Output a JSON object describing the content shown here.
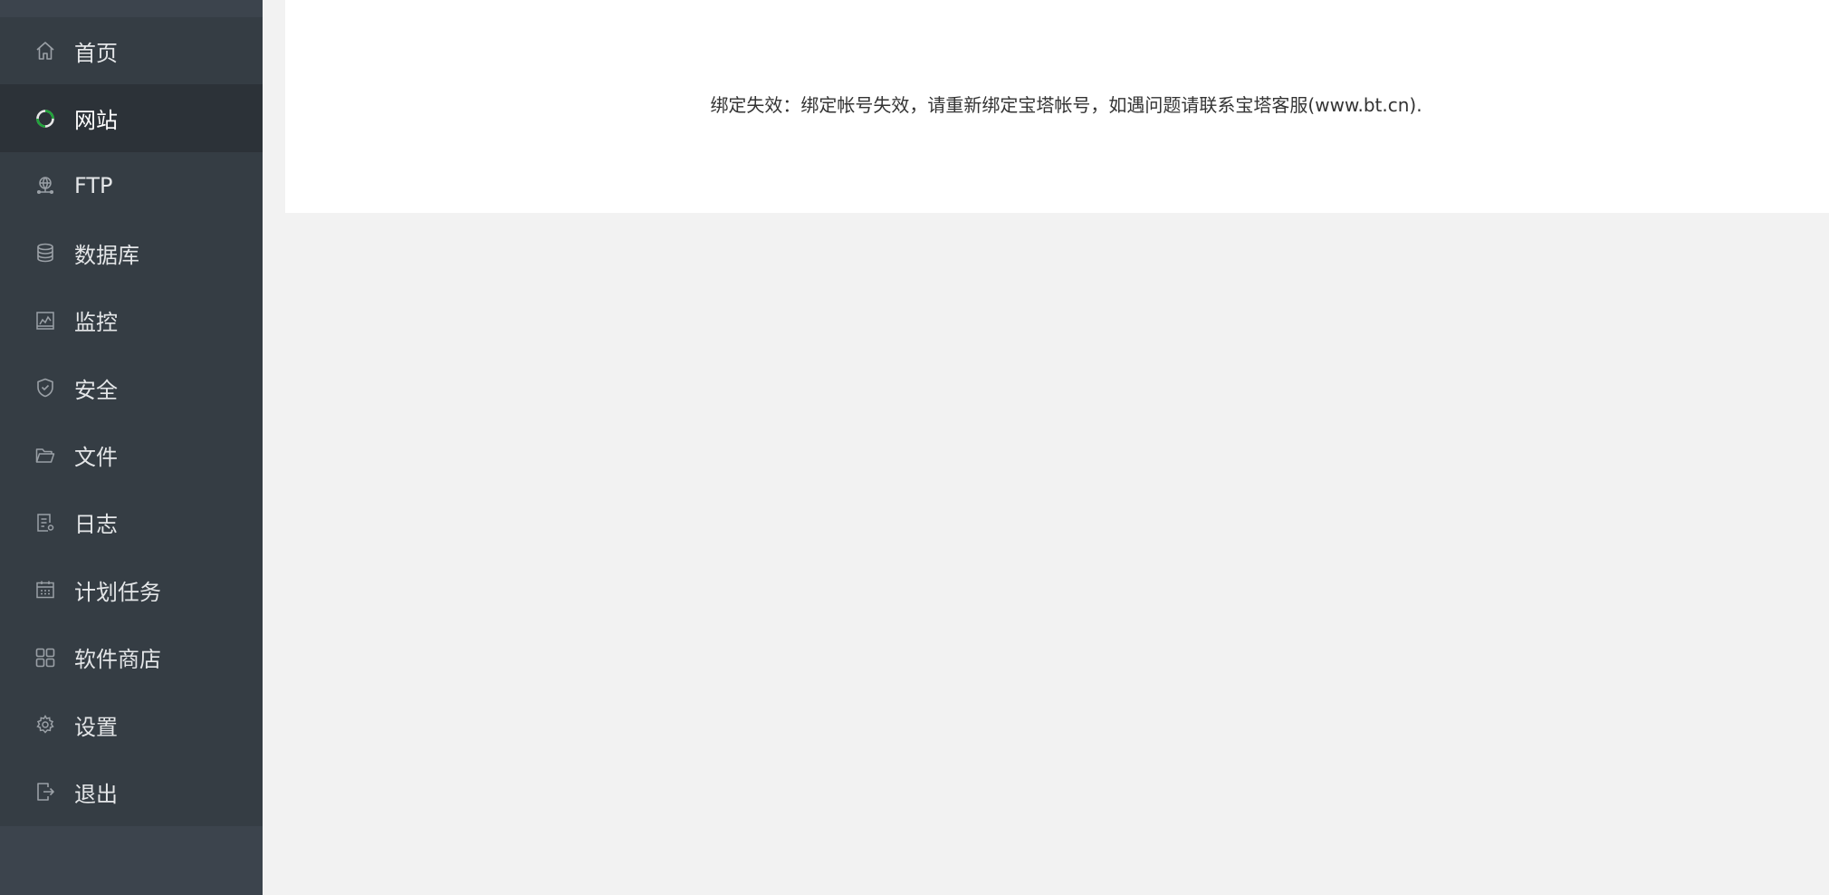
{
  "sidebar": {
    "items": [
      {
        "label": "首页",
        "icon": "home-icon"
      },
      {
        "label": "网站",
        "icon": "website-icon",
        "active": true
      },
      {
        "label": "FTP",
        "icon": "ftp-icon"
      },
      {
        "label": "数据库",
        "icon": "database-icon"
      },
      {
        "label": "监控",
        "icon": "monitor-icon"
      },
      {
        "label": "安全",
        "icon": "shield-icon"
      },
      {
        "label": "文件",
        "icon": "folder-icon"
      },
      {
        "label": "日志",
        "icon": "log-icon"
      },
      {
        "label": "计划任务",
        "icon": "calendar-icon"
      },
      {
        "label": "软件商店",
        "icon": "app-store-icon"
      },
      {
        "label": "设置",
        "icon": "gear-icon"
      },
      {
        "label": "退出",
        "icon": "logout-icon"
      }
    ]
  },
  "main": {
    "message": "绑定失效：绑定帐号失效，请重新绑定宝塔帐号，如遇问题请联系宝塔客服(www.bt.cn)."
  },
  "colors": {
    "sidebar_bg": "#3c444d",
    "menu_bg": "#353d44",
    "active_bg": "#2c3238",
    "accent_green": "#20a53a",
    "content_bg": "#f2f2f2",
    "panel_bg": "#ffffff"
  }
}
